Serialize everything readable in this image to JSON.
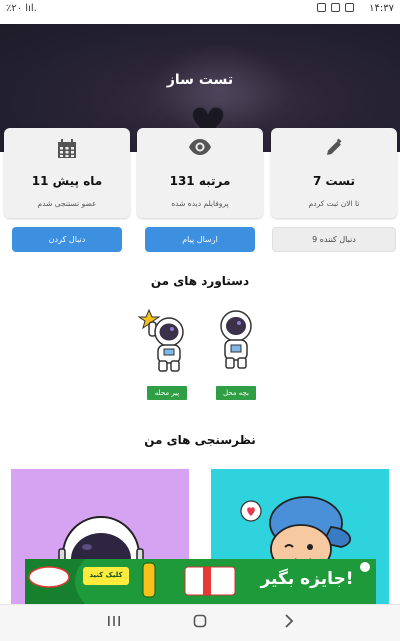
{
  "statusbar": {
    "time": "۱۴:۳۷",
    "signal_text": "٪۲۰ lıl."
  },
  "profile": {
    "title": "تست ساز"
  },
  "stats": [
    {
      "icon": "pencil-icon",
      "value": "7 تست",
      "caption": "تا الان ثبت کردم"
    },
    {
      "icon": "eye-icon",
      "value": "131 مرتبه",
      "caption": "پروفایلم دیده شده"
    },
    {
      "icon": "calendar-icon",
      "value": "11 ماه پیش",
      "caption": "عضو تستنجی شدم"
    }
  ],
  "actions": {
    "followers": "9 دنبال کننده",
    "send_message": "ارسال پیام",
    "follow": "دنبال کردن"
  },
  "achievements": {
    "title": "دستاورد های من",
    "items": [
      {
        "label": "بچه محل"
      },
      {
        "label": "پیر محله"
      }
    ]
  },
  "polls": {
    "title": "نظرسنجی های من"
  },
  "ad": {
    "banner_text": "جایزه بگیر!",
    "cta": "کلیک کنید"
  },
  "colors": {
    "accent": "#3d8fe0",
    "badge": "#2f9e44",
    "hero": "#2b2536",
    "poll_purple": "#d6a3f2",
    "poll_cyan": "#2fd3dd"
  }
}
